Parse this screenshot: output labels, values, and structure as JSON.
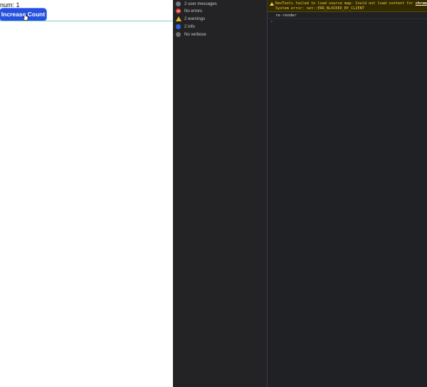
{
  "page": {
    "num_label": "num: 1",
    "button_label": "Increase Count"
  },
  "sidebar": {
    "items": [
      {
        "label": "2 user messages",
        "icon": "user-icon"
      },
      {
        "label": "No errors",
        "icon": "error-icon"
      },
      {
        "label": "2 warnings",
        "icon": "warning-icon"
      },
      {
        "label": "2 info",
        "icon": "info-icon"
      },
      {
        "label": "No verbose",
        "icon": "verbose-icon"
      }
    ]
  },
  "console": {
    "warning_line1": "DevTools failed to load source map: Could not load content for ",
    "warning_link": "chrome",
    "warning_line2": "System error: net::ERR_BLOCKED_BY_CLIENT",
    "log": "re-render",
    "prompt": "›"
  },
  "colors": {
    "button": "#2550e0",
    "warning": "#f2c94c",
    "console_bg": "#202124"
  }
}
